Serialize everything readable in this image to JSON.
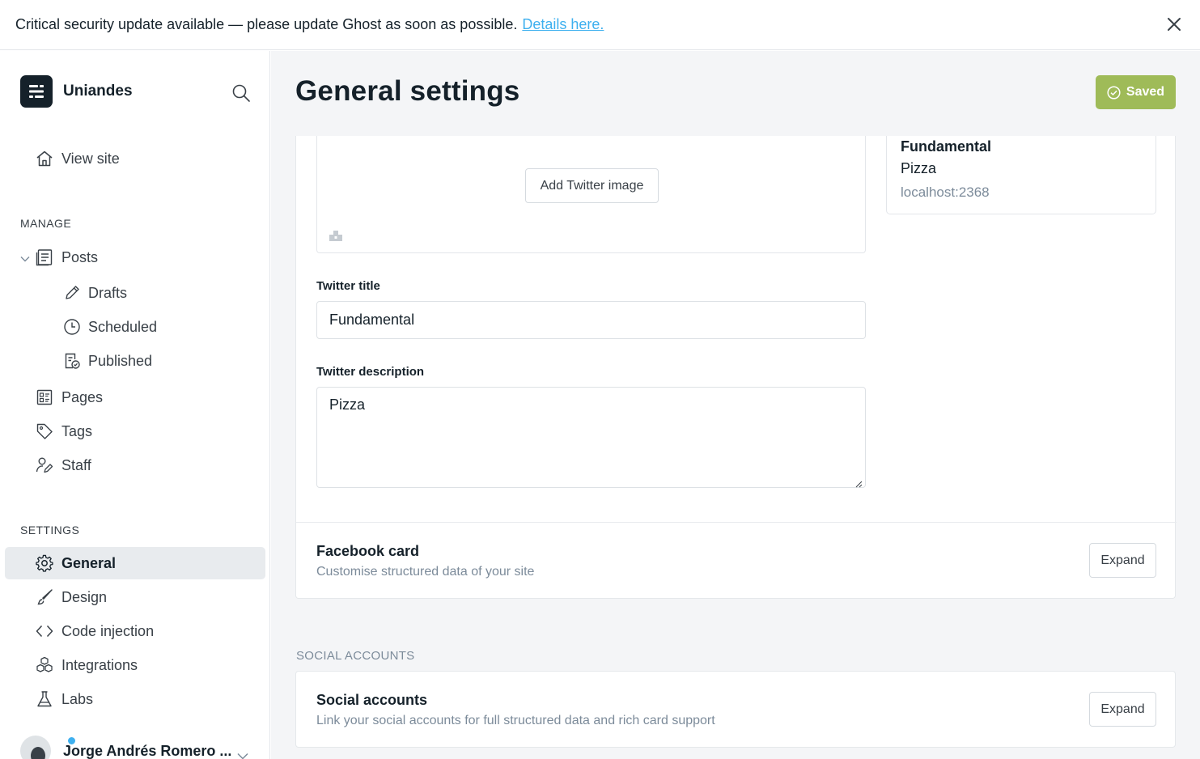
{
  "banner": {
    "message": "Critical security update available — please update Ghost as soon as possible.",
    "link_text": "Details here."
  },
  "sidebar": {
    "site_name": "Uniandes",
    "view_site": "View site",
    "manage_label": "MANAGE",
    "posts": "Posts",
    "drafts": "Drafts",
    "scheduled": "Scheduled",
    "published": "Published",
    "pages": "Pages",
    "tags": "Tags",
    "staff": "Staff",
    "settings_label": "SETTINGS",
    "general": "General",
    "design": "Design",
    "code_injection": "Code injection",
    "integrations": "Integrations",
    "labs": "Labs",
    "user_name": "Jorge Andrés Romero ..."
  },
  "main": {
    "title": "General settings",
    "saved_label": "Saved",
    "add_twitter_image": "Add Twitter image",
    "preview": {
      "title": "Fundamental",
      "description": "Pizza",
      "url": "localhost:2368"
    },
    "twitter_title_label": "Twitter title",
    "twitter_title_value": "Fundamental",
    "twitter_description_label": "Twitter description",
    "twitter_description_value": "Pizza",
    "facebook_card": {
      "title": "Facebook card",
      "subtitle": "Customise structured data of your site",
      "button": "Expand"
    },
    "social_section_label": "SOCIAL ACCOUNTS",
    "social_accounts": {
      "title": "Social accounts",
      "subtitle": "Link your social accounts for full structured data and rich card support",
      "button": "Expand"
    }
  },
  "colors": {
    "accent_link": "#3eb0ef",
    "saved_green": "#9fbb58",
    "active_nav_bg": "#e8ebee",
    "main_bg": "#f4f5f7"
  },
  "icons": [
    "close-icon",
    "ghost-logo-icon",
    "search-icon",
    "home-icon",
    "posts-icon",
    "pencil-icon",
    "clock-icon",
    "published-icon",
    "pages-icon",
    "tag-icon",
    "staff-icon",
    "gear-icon",
    "brush-icon",
    "code-icon",
    "integrations-icon",
    "flask-icon",
    "check-circle-icon",
    "image-placeholder-icon",
    "chevron-down-icon"
  ]
}
